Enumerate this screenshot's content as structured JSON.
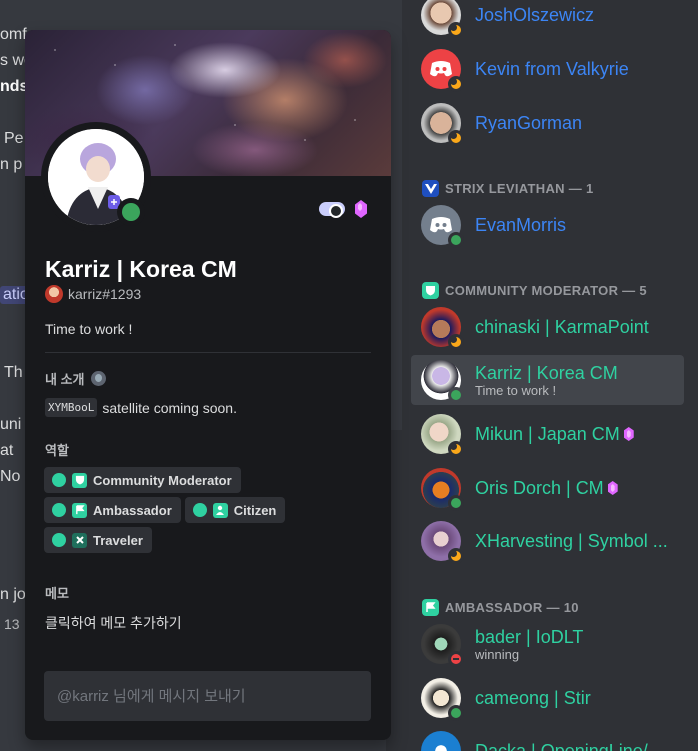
{
  "chat": {
    "fragments": [
      "omf",
      "s wo",
      "nds.",
      "Pe",
      "n p",
      "atio",
      "Th",
      "uni",
      "at",
      "No",
      "n jo",
      "13"
    ]
  },
  "popout": {
    "display_name": "Karriz | Korea CM",
    "username": "karriz#1293",
    "custom_status": "Time to work !",
    "about_title": "내 소개",
    "about_code": "XYMBooL",
    "about_text": "satellite coming soon.",
    "roles_title": "역할",
    "roles": [
      {
        "label": "Community Moderator",
        "color": "#2fd1a1"
      },
      {
        "label": "Ambassador",
        "color": "#2fd1a1"
      },
      {
        "label": "Citizen",
        "color": "#2fd1a1"
      },
      {
        "label": "Traveler",
        "color": "#2fd1a1"
      }
    ],
    "note_title": "메모",
    "note_placeholder": "클릭하여 메모 추가하기",
    "message_placeholder": "@karriz 님에게 메시지 보내기"
  },
  "member_list": {
    "top_members": [
      {
        "name": "JoshOlszewicz",
        "status": "idle"
      },
      {
        "name": "Kevin from Valkyrie",
        "status": "idle"
      },
      {
        "name": "RyanGorman",
        "status": "idle"
      }
    ],
    "groups": [
      {
        "header": "STRIX LEVIATHAN — 1",
        "members": [
          {
            "name": "EvanMorris",
            "status": "online"
          }
        ]
      },
      {
        "header": "COMMUNITY MODERATOR — 5",
        "members": [
          {
            "name": "chinaski | KarmaPoint",
            "status": "idle"
          },
          {
            "name": "Karriz | Korea CM",
            "sub": "Time to work !",
            "status": "online"
          },
          {
            "name": "Mikun | Japan CM",
            "status": "idle"
          },
          {
            "name": "Oris Dorch | CM",
            "status": "online"
          },
          {
            "name": "XHarvesting | Symbol ...",
            "status": "idle"
          }
        ]
      },
      {
        "header": "AMBASSADOR — 10",
        "members": [
          {
            "name": "bader | IoDLT",
            "sub": "winning",
            "status": "dnd"
          },
          {
            "name": "cameong | Stir",
            "status": "online"
          },
          {
            "name": "Dacka | OpeningLine/...",
            "status": "online"
          }
        ]
      }
    ]
  },
  "colors": {
    "accent_blue": "#3c85f5",
    "accent_teal": "#2fd1a1",
    "online": "#3ba55c",
    "idle": "#faa81a",
    "dnd": "#ed4245",
    "nitro_gem": "#e066ff"
  }
}
